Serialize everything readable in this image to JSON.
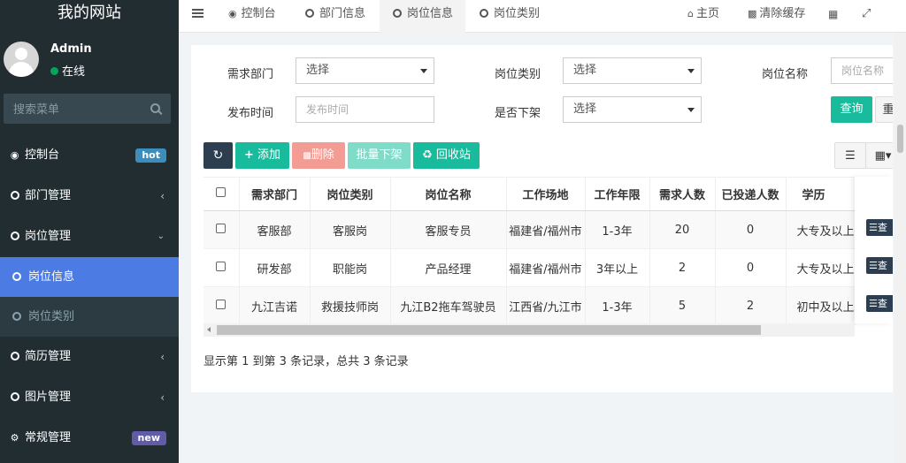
{
  "site_title": "我的网站",
  "user": {
    "name": "Admin",
    "status": "在线"
  },
  "search": {
    "placeholder": "搜索菜单"
  },
  "sidebar": {
    "items": [
      {
        "label": "控制台",
        "badge": "hot"
      },
      {
        "label": "部门管理"
      },
      {
        "label": "岗位管理"
      },
      {
        "label": "岗位信息"
      },
      {
        "label": "岗位类别"
      },
      {
        "label": "简历管理"
      },
      {
        "label": "图片管理"
      },
      {
        "label": "常规管理",
        "badge": "new"
      }
    ]
  },
  "tabs": [
    "控制台",
    "部门信息",
    "岗位信息",
    "岗位类别"
  ],
  "top_right": {
    "home": "主页",
    "clear_cache": "清除缓存"
  },
  "filters": {
    "dept_label": "需求部门",
    "dept_value": "选择",
    "category_label": "岗位类别",
    "category_value": "选择",
    "name_label": "岗位名称",
    "name_placeholder": "岗位名称",
    "publish_label": "发布时间",
    "publish_placeholder": "发布时间",
    "offline_label": "是否下架",
    "offline_value": "选择",
    "query_button": "查询",
    "reset_button": "重"
  },
  "toolbar": {
    "add": "添加",
    "delete": "删除",
    "batch_offline": "批量下架",
    "recycle": "回收站"
  },
  "table": {
    "headers": [
      "需求部门",
      "岗位类别",
      "岗位名称",
      "工作场地",
      "工作年限",
      "需求人数",
      "已投递人数",
      "学历"
    ],
    "rows": [
      [
        "客服部",
        "客服岗",
        "客服专员",
        "福建省/福州市",
        "1-3年",
        "20",
        "0",
        "大专及以上"
      ],
      [
        "研发部",
        "职能岗",
        "产品经理",
        "福建省/福州市",
        "3年以上",
        "2",
        "0",
        "大专及以上"
      ],
      [
        "九江吉诺",
        "救援技师岗",
        "九江B2拖车驾驶员",
        "江西省/九江市",
        "1-3年",
        "5",
        "2",
        "初中及以上"
      ]
    ],
    "op_label": "查"
  },
  "pagination": {
    "info": "显示第 1 到第 3 条记录，总共 3 条记录"
  },
  "colors": {
    "sidebar_bg": "#222d32",
    "active_blue": "#4c7be4",
    "teal": "#18bc9c",
    "dark": "#2c3e50"
  }
}
